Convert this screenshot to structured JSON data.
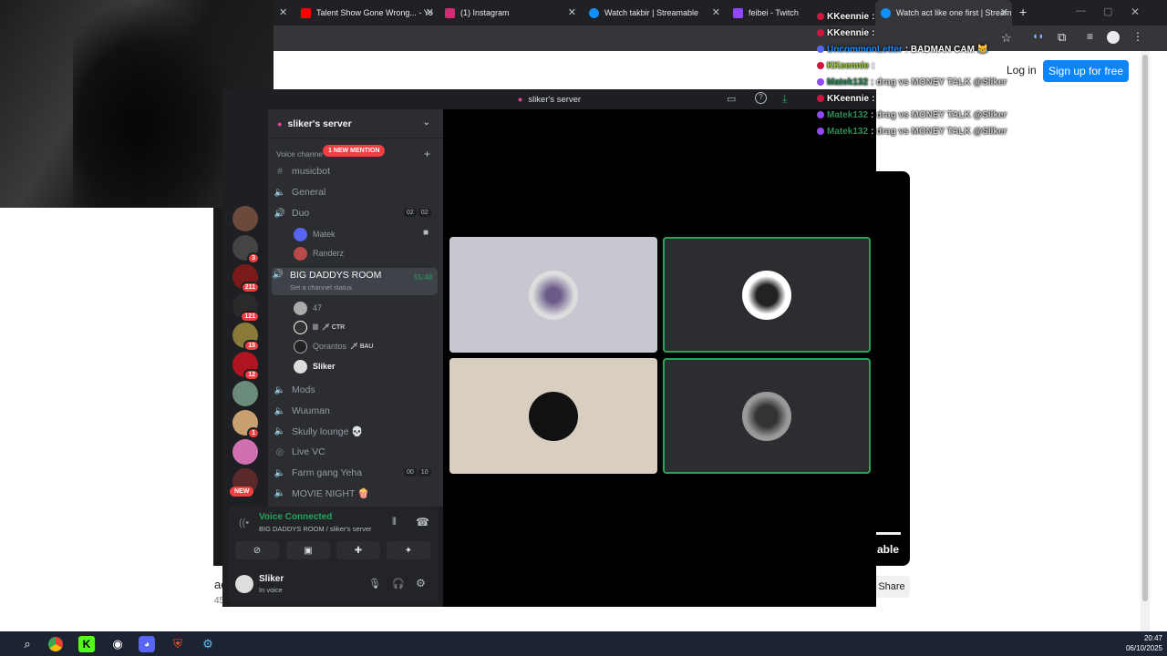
{
  "browser": {
    "tabs": [
      {
        "title": "Talent Show Gone Wrong... - Yo",
        "color": "#ff0000"
      },
      {
        "title": "(1) Instagram",
        "color": "#d62976"
      },
      {
        "title": "Watch takbir | Streamable",
        "color": "#0f90fa"
      },
      {
        "title": "feibei - Twitch",
        "color": "#9146ff"
      },
      {
        "title": "Watch act like one first | Stream",
        "color": "#0f90fa"
      }
    ],
    "new_tab": "+"
  },
  "page": {
    "login": "Log in",
    "signup": "Sign up for free",
    "share": "Share",
    "video_label": "able",
    "title_fragment": "ac",
    "views_fragment": "45"
  },
  "discord": {
    "window_title": "sliker's server",
    "server_name": "sliker's server",
    "category": "Voice channe",
    "mention_badge": "1 NEW MENTION",
    "channels": [
      {
        "name": "musicbot",
        "icon": "#"
      },
      {
        "name": "General",
        "icon": "speaker"
      },
      {
        "name": "Duo",
        "icon": "speaker",
        "counts": [
          "02",
          "02"
        ]
      },
      {
        "name": "BIG DADDYS ROOM",
        "icon": "speaker",
        "status": "Set a channel status",
        "timer": "55:48"
      },
      {
        "name": "Mods",
        "icon": "speaker"
      },
      {
        "name": "Wuuman",
        "icon": "speaker"
      },
      {
        "name": "Skully lounge 💀",
        "icon": "speaker"
      },
      {
        "name": "Live VC",
        "icon": "stage"
      },
      {
        "name": "Farm gang Yeha",
        "icon": "speaker",
        "counts": [
          "00",
          "10"
        ]
      },
      {
        "name": "MOVIE NIGHT 🍿",
        "icon": "speaker"
      }
    ],
    "duo_users": [
      "Matek",
      "Randerz"
    ],
    "room_users": [
      {
        "name": "47",
        "tag": ""
      },
      {
        "name": "lll",
        "tag": "🗡 CTR"
      },
      {
        "name": "Qorantos",
        "tag": "🗡 BAU"
      },
      {
        "name": "Sliker",
        "tag": ""
      }
    ],
    "guild_badges": [
      "3",
      "211",
      "121",
      "15",
      "12",
      "1"
    ],
    "new_label": "NEW",
    "voice": {
      "status": "Voice Connected",
      "location": "BIG DADDYS ROOM / sliker's server"
    },
    "user": {
      "name": "Sliker",
      "state": "In voice"
    }
  },
  "chat": [
    {
      "user": "KKeennie",
      "color": "#ffffff",
      "msg": ":"
    },
    {
      "user": "KKeennie",
      "color": "#ffffff",
      "msg": ":"
    },
    {
      "user": "UncommonLetter",
      "color": "#1e90ff",
      "msg": ": BADMAN CAM 😹"
    },
    {
      "user": "KKeennie",
      "color": "#9acd32",
      "msg": ":"
    },
    {
      "user": "Matek132",
      "color": "#2e8b57",
      "msg": ": drag vs MONEY TALK @Sliker"
    },
    {
      "user": "KKeennie",
      "color": "#ffffff",
      "msg": ":"
    },
    {
      "user": "Matek132",
      "color": "#2e8b57",
      "msg": ": drag vs MONEY TALK @Sliker"
    },
    {
      "user": "Matek132",
      "color": "#2e8b57",
      "msg": ": drag vs MONEY TALK @Sliker"
    }
  ],
  "taskbar": {
    "time": "20:47",
    "date": "06/10/2025"
  }
}
